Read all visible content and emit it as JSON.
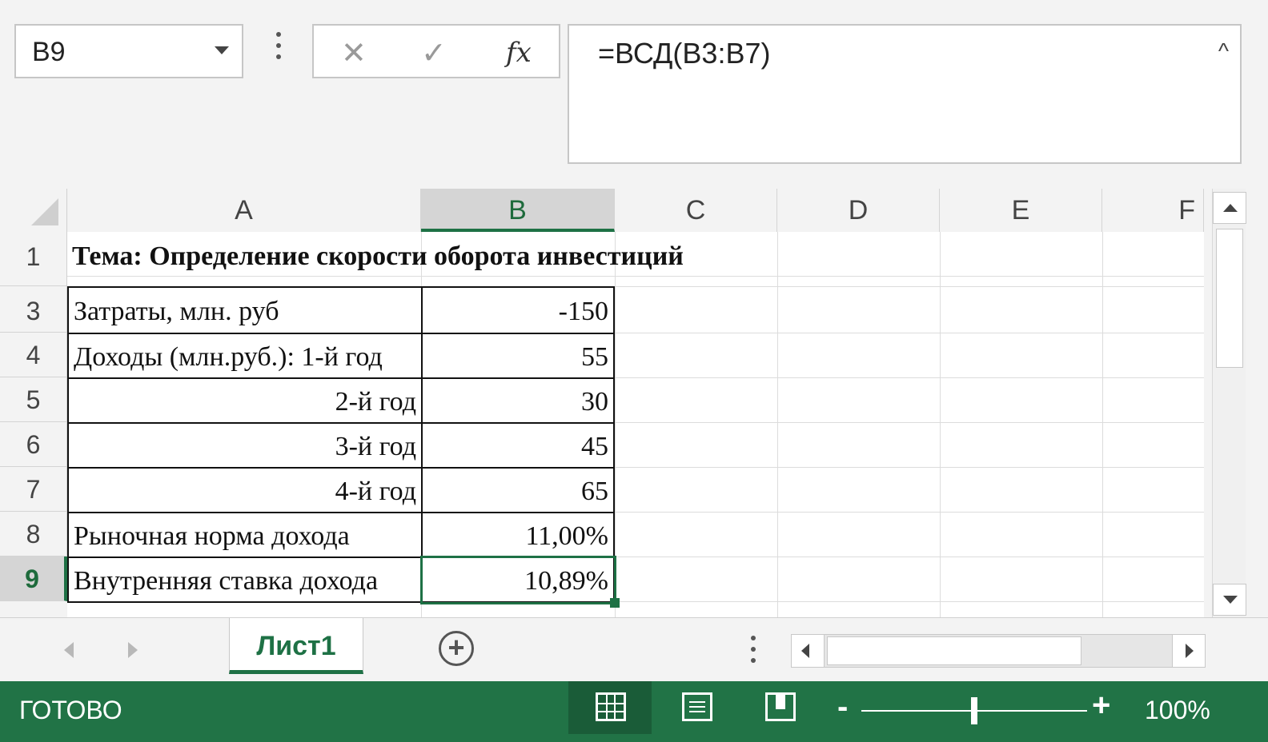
{
  "formula_bar": {
    "name_box": "B9",
    "cancel_icon": "✕",
    "enter_icon": "✓",
    "fx_label": "fx",
    "formula": "=ВСД(B3:B7)",
    "collapse_icon": "^"
  },
  "columns": [
    "A",
    "B",
    "C",
    "D",
    "E",
    "F"
  ],
  "selected_column": "B",
  "rows": [
    "1",
    "3",
    "4",
    "5",
    "6",
    "7",
    "8",
    "9"
  ],
  "selected_row": "9",
  "cells": {
    "A1": "Тема: Определение скорости оборота инвестиций",
    "A3": "Затраты, млн. руб",
    "B3": "-150",
    "A4": "Доходы (млн.руб.):   1-й год",
    "B4": "55",
    "A5": "2-й год",
    "B5": "30",
    "A6": "3-й год",
    "B6": "45",
    "A7": "4-й год",
    "B7": "65",
    "A8": "Рыночная норма дохода",
    "B8": "11,00%",
    "A9": "Внутренняя ставка дохода",
    "B9": "10,89%"
  },
  "sheet_tabs": [
    "Лист1"
  ],
  "status_bar": {
    "status": "ГОТОВО",
    "zoom_minus": "-",
    "zoom_plus": "+",
    "zoom_level": "100%",
    "zoom_fraction": 0.5
  },
  "colors": {
    "accent": "#217346",
    "selection": "#1e7145"
  }
}
